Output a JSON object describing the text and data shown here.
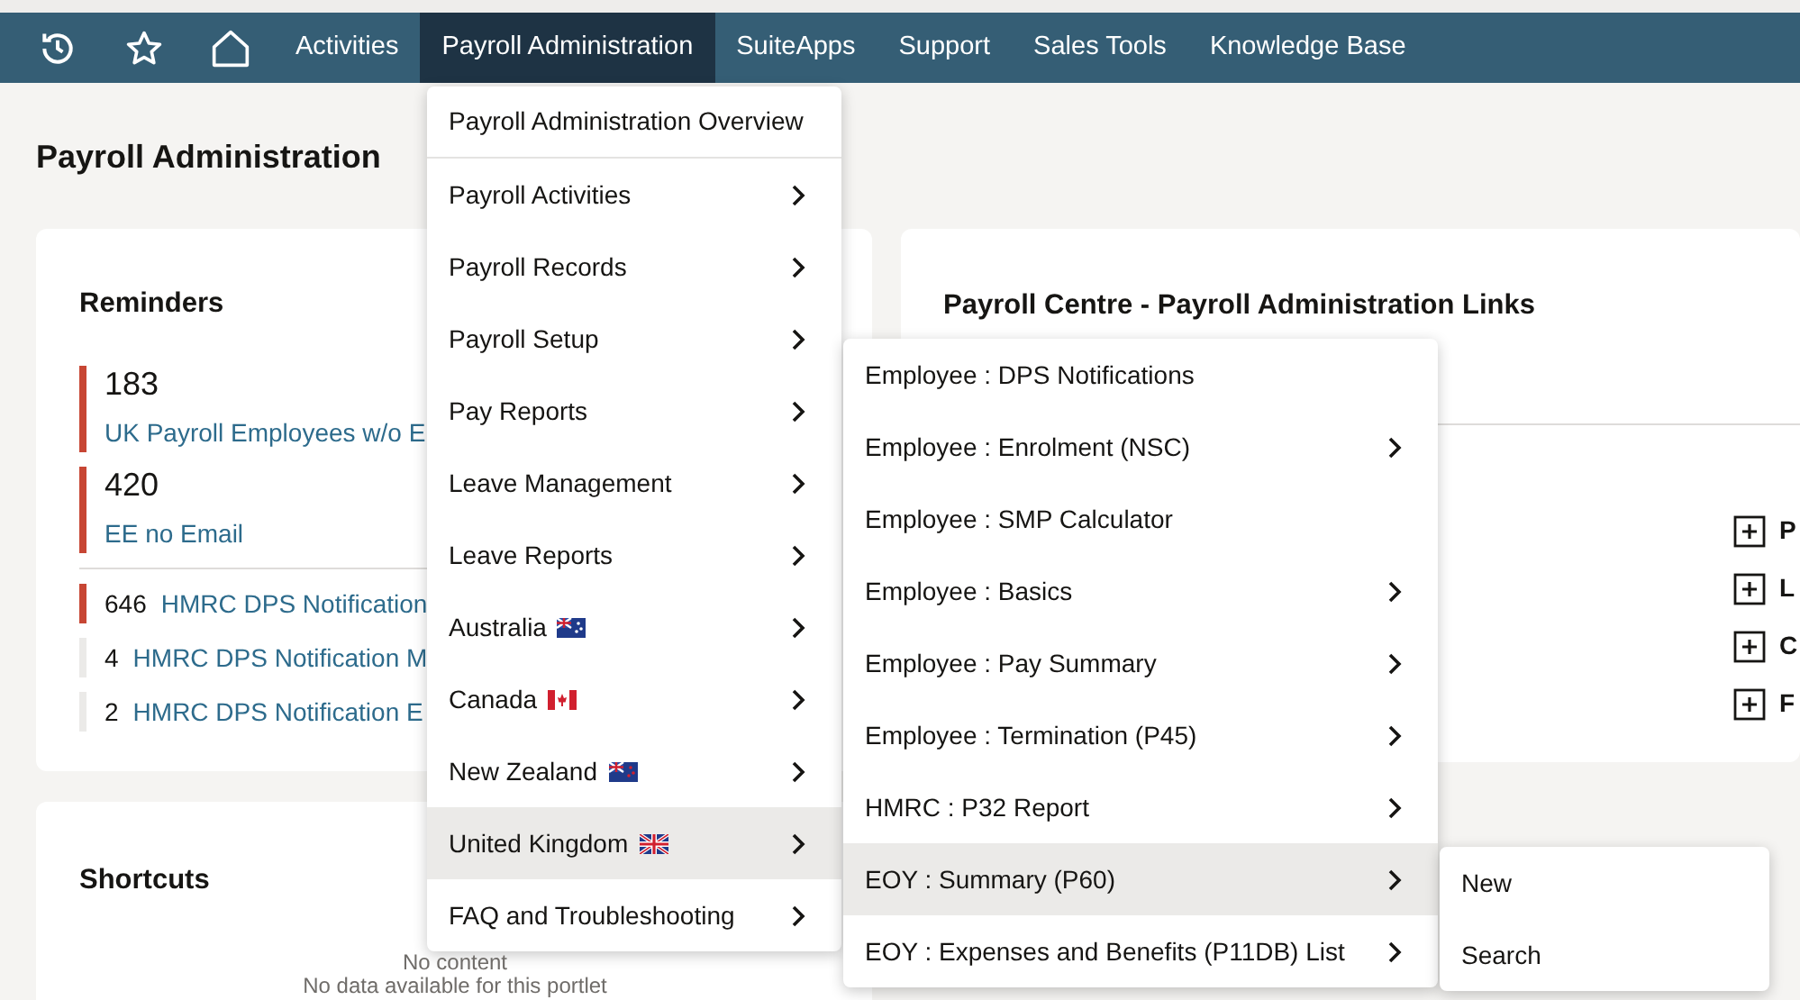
{
  "nav": {
    "tabs": [
      {
        "label": "Activities",
        "selected": false
      },
      {
        "label": "Payroll Administration",
        "selected": true
      },
      {
        "label": "SuiteApps",
        "selected": false
      },
      {
        "label": "Support",
        "selected": false
      },
      {
        "label": "Sales Tools",
        "selected": false
      },
      {
        "label": "Knowledge Base",
        "selected": false
      }
    ]
  },
  "page_title": "Payroll Administration",
  "reminders": {
    "title": "Reminders",
    "big": [
      {
        "value": "183",
        "label": "UK Payroll Employees w/o E"
      },
      {
        "value": "420",
        "label": "EE no Email"
      }
    ],
    "small": [
      {
        "count": "646",
        "label": "HMRC DPS Notification",
        "highlighted": true
      },
      {
        "count": "4",
        "label": "HMRC DPS Notification M",
        "highlighted": false
      },
      {
        "count": "2",
        "label": "HMRC DPS Notification E",
        "highlighted": false
      }
    ]
  },
  "links_card": {
    "title": "Payroll Centre - Payroll Administration Links",
    "items": [
      "P",
      "L",
      "C",
      "F"
    ]
  },
  "shortcuts": {
    "title": "Shortcuts",
    "empty_title": "No content",
    "empty_text": "No data available for this portlet"
  },
  "menus": [
    {
      "items": [
        {
          "label": "Payroll Administration Overview",
          "submenu": false,
          "selected": false,
          "kind": "plain"
        },
        {
          "label": "Payroll Activities",
          "submenu": true,
          "selected": false,
          "kind": "plain"
        },
        {
          "label": "Payroll Records",
          "submenu": true,
          "selected": false,
          "kind": "plain"
        },
        {
          "label": "Payroll Setup",
          "submenu": true,
          "selected": false,
          "kind": "plain"
        },
        {
          "label": "Pay Reports",
          "submenu": true,
          "selected": false,
          "kind": "plain"
        },
        {
          "label": "Leave Management",
          "submenu": true,
          "selected": false,
          "kind": "plain"
        },
        {
          "label": "Leave Reports",
          "submenu": true,
          "selected": false,
          "kind": "plain"
        },
        {
          "label": "Australia",
          "submenu": true,
          "selected": false,
          "kind": "australia"
        },
        {
          "label": "Canada",
          "submenu": true,
          "selected": false,
          "kind": "canada"
        },
        {
          "label": "New Zealand",
          "submenu": true,
          "selected": false,
          "kind": "newzealand"
        },
        {
          "label": "United Kingdom",
          "submenu": true,
          "selected": true,
          "kind": "uk"
        },
        {
          "label": "FAQ and Troubleshooting",
          "submenu": true,
          "selected": false,
          "kind": "plain"
        }
      ]
    },
    {
      "items": [
        {
          "label": "Employee : DPS Notifications",
          "submenu": false,
          "selected": false
        },
        {
          "label": "Employee : Enrolment (NSC)",
          "submenu": true,
          "selected": false
        },
        {
          "label": "Employee : SMP Calculator",
          "submenu": false,
          "selected": false
        },
        {
          "label": "Employee : Basics",
          "submenu": true,
          "selected": false
        },
        {
          "label": "Employee : Pay Summary",
          "submenu": true,
          "selected": false
        },
        {
          "label": "Employee : Termination (P45)",
          "submenu": true,
          "selected": false
        },
        {
          "label": "HMRC : P32 Report",
          "submenu": true,
          "selected": false
        },
        {
          "label": "EOY : Summary (P60)",
          "submenu": true,
          "selected": true
        },
        {
          "label": "EOY : Expenses and Benefits (P11DB) List",
          "submenu": true,
          "selected": false
        }
      ]
    },
    {
      "items": [
        {
          "label": "New",
          "submenu": false,
          "selected": false
        },
        {
          "label": "Search",
          "submenu": false,
          "selected": false
        }
      ]
    }
  ]
}
